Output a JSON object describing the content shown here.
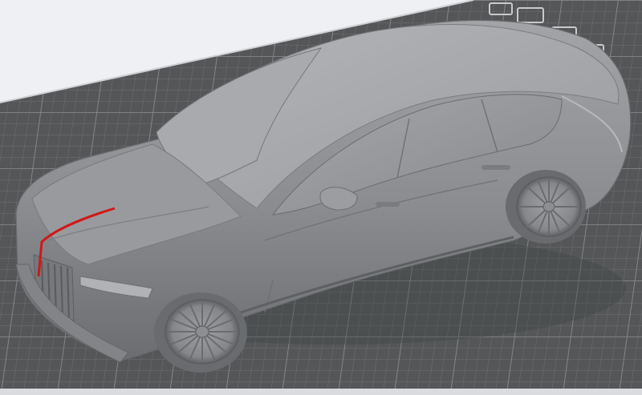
{
  "viewer": {
    "type": "slicer-3d-preview",
    "model_icon": "car-icon",
    "selection_color": "#d01818",
    "bed_color": "#545657",
    "grid_color": "#707274",
    "model_color": "#8f9093",
    "background_color": "#eef0f3"
  },
  "bed": {
    "label_glyphs": [
      "nozzle-mark-icon",
      "plate-label-icon",
      "plate-label-icon",
      "plate-label-icon"
    ]
  }
}
